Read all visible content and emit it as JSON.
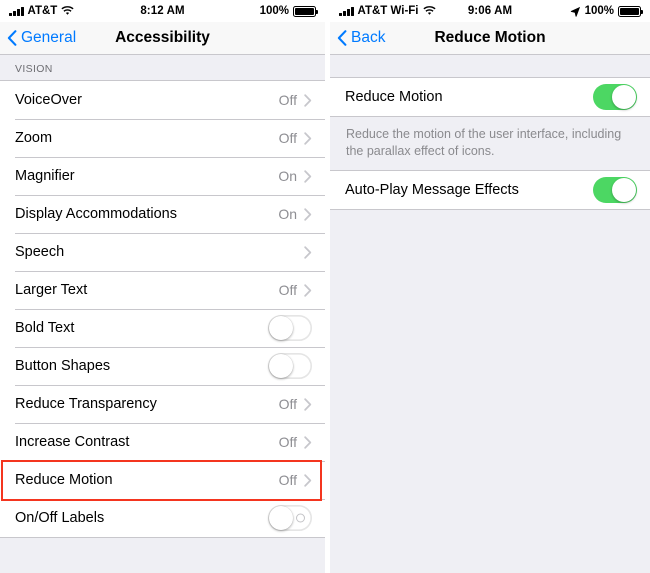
{
  "left": {
    "statusbar": {
      "carrier": "AT&T",
      "time": "8:12 AM",
      "battery_pct": "100%",
      "signal_icon": "signal-bars-icon",
      "wifi_icon": "wifi-icon",
      "battery_icon": "battery-full-icon"
    },
    "nav": {
      "back_label": "General",
      "back_icon": "chevron-left-icon",
      "title": "Accessibility"
    },
    "section_header": "VISION",
    "rows": [
      {
        "label": "VoiceOver",
        "value": "Off",
        "type": "disclosure"
      },
      {
        "label": "Zoom",
        "value": "Off",
        "type": "disclosure"
      },
      {
        "label": "Magnifier",
        "value": "On",
        "type": "disclosure"
      },
      {
        "label": "Display Accommodations",
        "value": "On",
        "type": "disclosure"
      },
      {
        "label": "Speech",
        "value": "",
        "type": "disclosure"
      },
      {
        "label": "Larger Text",
        "value": "Off",
        "type": "disclosure"
      },
      {
        "label": "Bold Text",
        "value": "",
        "type": "toggle",
        "state": "off"
      },
      {
        "label": "Button Shapes",
        "value": "",
        "type": "toggle",
        "state": "off"
      },
      {
        "label": "Reduce Transparency",
        "value": "Off",
        "type": "disclosure"
      },
      {
        "label": "Increase Contrast",
        "value": "Off",
        "type": "disclosure"
      },
      {
        "label": "Reduce Motion",
        "value": "Off",
        "type": "disclosure",
        "highlighted": true
      },
      {
        "label": "On/Off Labels",
        "value": "",
        "type": "toggle",
        "state": "off",
        "labeled": true
      }
    ]
  },
  "right": {
    "statusbar": {
      "carrier": "AT&T Wi-Fi",
      "time": "9:06 AM",
      "battery_pct": "100%",
      "signal_icon": "signal-bars-icon",
      "wifi_icon": "wifi-icon",
      "location_icon": "location-arrow-icon",
      "battery_icon": "battery-full-icon"
    },
    "nav": {
      "back_label": "Back",
      "back_icon": "chevron-left-icon",
      "title": "Reduce Motion"
    },
    "rows": [
      {
        "label": "Reduce Motion",
        "type": "toggle",
        "state": "on"
      }
    ],
    "footer_note": "Reduce the motion of the user interface, including the parallax effect of icons.",
    "rows2": [
      {
        "label": "Auto-Play Message Effects",
        "type": "toggle",
        "state": "on"
      }
    ]
  },
  "colors": {
    "accent_blue": "#007aff",
    "toggle_on_green": "#4cd763",
    "highlight_red": "#f4351f",
    "value_gray": "#8e8e93",
    "group_bg": "#efeff4"
  }
}
